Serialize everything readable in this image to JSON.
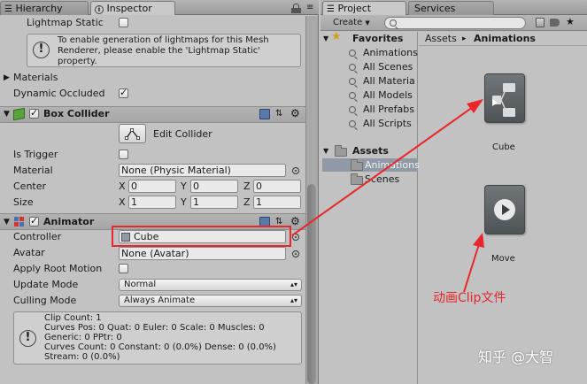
{
  "inspector_panel": {
    "tabs": [
      {
        "label": "Hierarchy"
      },
      {
        "label": "Inspector"
      }
    ],
    "lightmap_static": {
      "label": "Lightmap Static",
      "checked": false
    },
    "lightmap_help": {
      "line1": "To enable generation of lightmaps for this Mesh",
      "line2": "Renderer, please enable the 'Lightmap Static'",
      "line3": "property."
    },
    "materials_label": "Materials",
    "dynamic_occluded": {
      "label": "Dynamic Occluded",
      "checked": true
    },
    "box_collider": {
      "title": "Box Collider",
      "edit_collider_label": "Edit Collider",
      "is_trigger_label": "Is Trigger",
      "material_label": "Material",
      "material_value": "None (Physic Material)",
      "center_label": "Center",
      "center": {
        "x": "0",
        "y": "0",
        "z": "0"
      },
      "size_label": "Size",
      "size": {
        "x": "1",
        "y": "1",
        "z": "1"
      },
      "axis_x": "X",
      "axis_y": "Y",
      "axis_z": "Z"
    },
    "animator": {
      "title": "Animator",
      "controller_label": "Controller",
      "controller_value": "Cube",
      "avatar_label": "Avatar",
      "avatar_value": "None (Avatar)",
      "apply_root_motion_label": "Apply Root Motion",
      "update_mode_label": "Update Mode",
      "update_mode_value": "Normal",
      "culling_mode_label": "Culling Mode",
      "culling_mode_value": "Always Animate",
      "info_lines": [
        "Clip Count: 1",
        "Curves Pos: 0 Quat: 0 Euler: 0 Scale: 0 Muscles: 0",
        "Generic: 0 PPtr: 0",
        "Curves Count: 0 Constant: 0 (0.0%) Dense: 0 (0.0%)",
        "Stream: 0 (0.0%)"
      ]
    }
  },
  "project_panel": {
    "tabs": [
      {
        "label": "Project"
      },
      {
        "label": "Services"
      }
    ],
    "create_label": "Create",
    "favorites": {
      "label": "Favorites",
      "items": [
        "Animations",
        "All Scenes",
        "All Materia",
        "All Models",
        "All Prefabs",
        "All Scripts"
      ]
    },
    "assets_tree": {
      "label": "Assets",
      "items": [
        "Animations",
        "Scenes"
      ]
    },
    "breadcrumb": {
      "root": "Assets",
      "separator": "▸",
      "current": "Animations"
    },
    "assets": [
      {
        "name": "Cube"
      },
      {
        "name": "Move"
      }
    ]
  },
  "annotation": {
    "label": "动画Clip文件",
    "color": "#e8262b"
  },
  "watermark": "知乎 @大智",
  "colors": {
    "panel_bg": "#c2c2c2",
    "highlight": "#e8262b",
    "selection": "#8f9aa6"
  }
}
